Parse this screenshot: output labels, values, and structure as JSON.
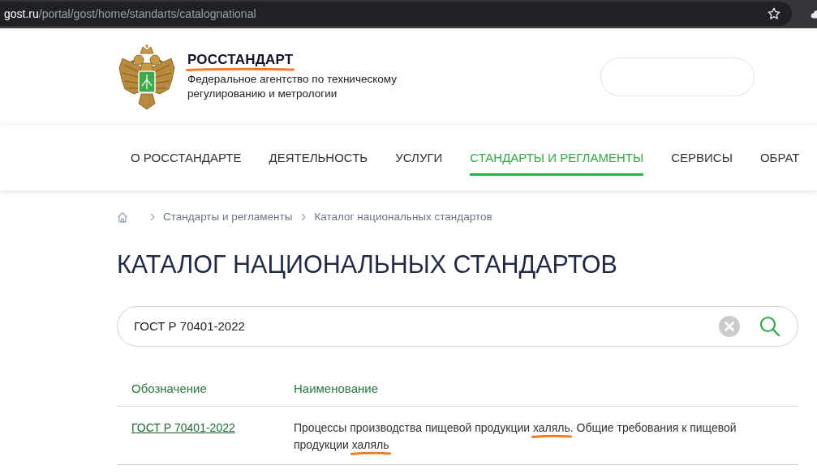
{
  "browser": {
    "url_host": "gost.ru",
    "url_path": "/portal/gost/home/standarts/catalognational"
  },
  "header": {
    "brand": {
      "text": "РОССТАНДАРТ",
      "marked": true
    },
    "subtitle": "Федеральное агентство по техническому регулированию и метрологии"
  },
  "nav": [
    {
      "label": "О РОССТАНДАРТЕ",
      "selected": false
    },
    {
      "label": "ДЕЯТЕЛЬНОСТЬ",
      "selected": false
    },
    {
      "label": "УСЛУГИ",
      "selected": false
    },
    {
      "label": "СТАНДАРТЫ И РЕГЛАМЕНТЫ",
      "selected": true
    },
    {
      "label": "СЕРВИСЫ",
      "selected": false
    },
    {
      "label": "ОБРАТ",
      "selected": false
    }
  ],
  "breadcrumb": [
    {
      "label": "Стандарты и регламенты"
    },
    {
      "label": "Каталог национальных стандартов"
    }
  ],
  "page_title": "КАТАЛОГ НАЦИОНАЛЬНЫХ СТАНДАРТОВ",
  "search": {
    "value": "ГОСТ Р 70401-2022"
  },
  "table": {
    "columns": [
      "Обозначение",
      "Наименование"
    ],
    "rows": [
      {
        "designation": "ГОСТ Р 70401-2022",
        "name_segments": [
          {
            "text": "Процессы производства пищевой продукции ",
            "marked": false
          },
          {
            "text": "халяль",
            "marked": true
          },
          {
            "text": ". Общие требования к пищевой продукции ",
            "marked": false
          },
          {
            "text": "халяль",
            "marked": true
          }
        ]
      }
    ]
  }
}
